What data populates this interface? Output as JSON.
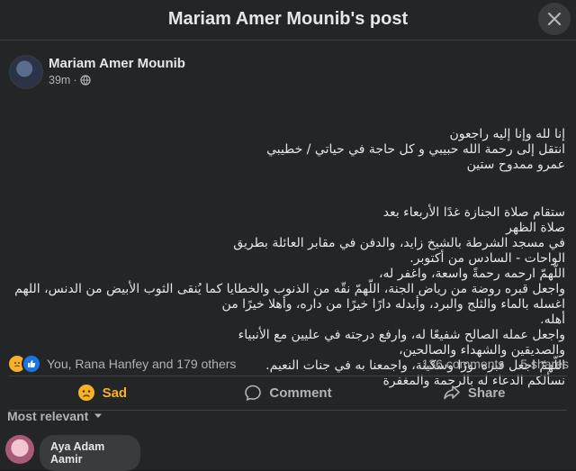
{
  "header": {
    "title": "Mariam Amer Mounib's post"
  },
  "post": {
    "author": "Mariam Amer Mounib",
    "time": "39m",
    "paragraph1": "إنا لله وإنا إليه راجعون\nانتقل إلى رحمة الله حبيبي و كل حاجة في حياتي / خطيبي\nعمرو ممدوح ستين",
    "paragraph2": "ستقام صلاة الجنازة غدًا الأربعاء بعد\nصلاة الظهر\nفي مسجد الشرطة بالشيخ زايد، والدفن في مقابر العائلة بطريق\nالواحات - السادس من أكتوبر.\nاللّهمّ ارحمه رحمةً واسعة، واغفر له،\nواجعل قبره روضة من رياض الجنة، اللّهمّ نقّه من الذنوب والخطايا كما يُنقى الثوب الأبيض من الدنس، اللهم\nاغسله بالماء والثلج والبرد، وأبدله دارًا خيرًا من داره، وأهلا خيرًا من\nأهله.\nواجعل عمله الصالح شفيعًا له، وارفع درجته في عليين مع الأنبياء\nوالصديقين والشهداء والصالحين،\nاللّهمّ اجعل قبره نورًا وسكينة، واجمعنا به في جنات النعيم.\nنسألكم الدعاء له بالرحمة والمغفرة"
  },
  "stats": {
    "reactions_text": "You, Rana Hanfey and 179 others",
    "comments": "136 comments",
    "shares": "5 shares"
  },
  "actions": {
    "sad": "Sad",
    "comment": "Comment",
    "share": "Share"
  },
  "sort": {
    "label": "Most relevant"
  },
  "comment": {
    "name": "Aya Adam Aamir"
  },
  "colors": {
    "background": "#242526",
    "sad": "#f7b125",
    "like": "#1b74e4"
  }
}
